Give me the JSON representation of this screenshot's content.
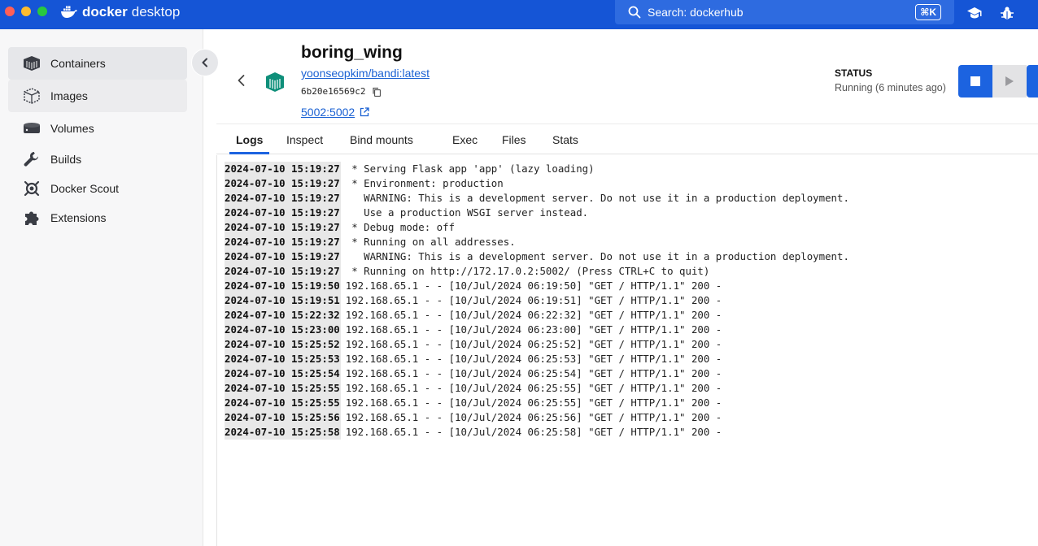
{
  "app": {
    "brand_primary": "docker",
    "brand_secondary": "desktop",
    "search_text": "Search: dockerhub",
    "search_shortcut": "⌘K"
  },
  "colors": {
    "titlebar": "#1555d6",
    "accent": "#1c63e0",
    "link": "#1a61d3",
    "container_icon": "#0f8f7a"
  },
  "sidebar": {
    "items": [
      {
        "label": "Containers",
        "icon": "container-icon"
      },
      {
        "label": "Images",
        "icon": "image-icon"
      },
      {
        "label": "Volumes",
        "icon": "volume-icon"
      },
      {
        "label": "Builds",
        "icon": "wrench-icon"
      },
      {
        "label": "Docker Scout",
        "icon": "scout-icon"
      },
      {
        "label": "Extensions",
        "icon": "puzzle-icon"
      }
    ]
  },
  "container": {
    "name": "boring_wing",
    "image": "yoonseopkim/bandi:latest",
    "id": "6b20e16569c2",
    "port": "5002:5002",
    "status_label": "STATUS",
    "status_value": "Running (6 minutes ago)"
  },
  "tabs": [
    "Logs",
    "Inspect",
    "Bind mounts",
    "Exec",
    "Files",
    "Stats"
  ],
  "active_tab": "Logs",
  "logs": [
    {
      "ts": "2024-07-10 15:19:27",
      "msg": " * Serving Flask app 'app' (lazy loading)"
    },
    {
      "ts": "2024-07-10 15:19:27",
      "msg": " * Environment: production"
    },
    {
      "ts": "2024-07-10 15:19:27",
      "msg": "   WARNING: This is a development server. Do not use it in a production deployment."
    },
    {
      "ts": "2024-07-10 15:19:27",
      "msg": "   Use a production WSGI server instead."
    },
    {
      "ts": "2024-07-10 15:19:27",
      "msg": " * Debug mode: off"
    },
    {
      "ts": "2024-07-10 15:19:27",
      "msg": " * Running on all addresses."
    },
    {
      "ts": "2024-07-10 15:19:27",
      "msg": "   WARNING: This is a development server. Do not use it in a production deployment."
    },
    {
      "ts": "2024-07-10 15:19:27",
      "msg": " * Running on http://172.17.0.2:5002/ (Press CTRL+C to quit)"
    },
    {
      "ts": "2024-07-10 15:19:50",
      "msg": "192.168.65.1 - - [10/Jul/2024 06:19:50] \"GET / HTTP/1.1\" 200 -"
    },
    {
      "ts": "2024-07-10 15:19:51",
      "msg": "192.168.65.1 - - [10/Jul/2024 06:19:51] \"GET / HTTP/1.1\" 200 -"
    },
    {
      "ts": "2024-07-10 15:22:32",
      "msg": "192.168.65.1 - - [10/Jul/2024 06:22:32] \"GET / HTTP/1.1\" 200 -"
    },
    {
      "ts": "2024-07-10 15:23:00",
      "msg": "192.168.65.1 - - [10/Jul/2024 06:23:00] \"GET / HTTP/1.1\" 200 -"
    },
    {
      "ts": "2024-07-10 15:25:52",
      "msg": "192.168.65.1 - - [10/Jul/2024 06:25:52] \"GET / HTTP/1.1\" 200 -"
    },
    {
      "ts": "2024-07-10 15:25:53",
      "msg": "192.168.65.1 - - [10/Jul/2024 06:25:53] \"GET / HTTP/1.1\" 200 -"
    },
    {
      "ts": "2024-07-10 15:25:54",
      "msg": "192.168.65.1 - - [10/Jul/2024 06:25:54] \"GET / HTTP/1.1\" 200 -"
    },
    {
      "ts": "2024-07-10 15:25:55",
      "msg": "192.168.65.1 - - [10/Jul/2024 06:25:55] \"GET / HTTP/1.1\" 200 -"
    },
    {
      "ts": "2024-07-10 15:25:55",
      "msg": "192.168.65.1 - - [10/Jul/2024 06:25:55] \"GET / HTTP/1.1\" 200 -"
    },
    {
      "ts": "2024-07-10 15:25:56",
      "msg": "192.168.65.1 - - [10/Jul/2024 06:25:56] \"GET / HTTP/1.1\" 200 -"
    },
    {
      "ts": "2024-07-10 15:25:58",
      "msg": "192.168.65.1 - - [10/Jul/2024 06:25:58] \"GET / HTTP/1.1\" 200 -"
    }
  ]
}
